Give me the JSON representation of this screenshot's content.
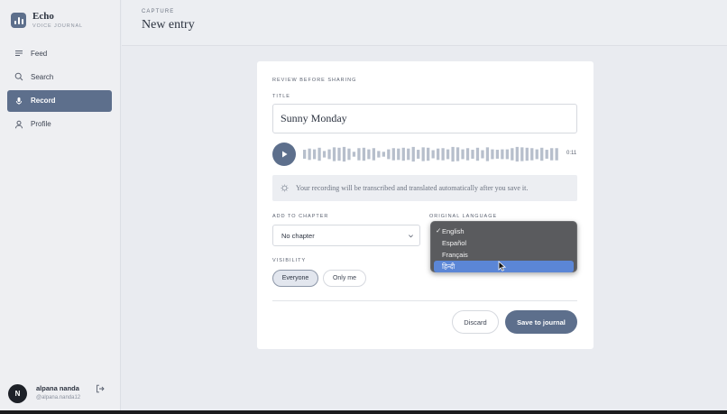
{
  "brand": {
    "name": "Echo",
    "subtitle": "VOICE JOURNAL"
  },
  "sidebar": {
    "items": [
      {
        "label": "Feed",
        "icon": "list-icon",
        "active": false
      },
      {
        "label": "Search",
        "icon": "search-icon",
        "active": false
      },
      {
        "label": "Record",
        "icon": "mic-icon",
        "active": true
      },
      {
        "label": "Profile",
        "icon": "user-icon",
        "active": false
      }
    ]
  },
  "user": {
    "initial": "N",
    "name": "alpana nanda",
    "handle": "@alpana.nanda12"
  },
  "header": {
    "crumb": "CAPTURE",
    "title": "New entry"
  },
  "card": {
    "heading": "REVIEW BEFORE SHARING",
    "title_label": "TITLE",
    "title_value": "Sunny Monday",
    "duration": "0:11",
    "notice": "Your recording will be transcribed and translated automatically after you save it.",
    "chapter_label": "ADD TO CHAPTER",
    "chapter_value": "No chapter",
    "language_label": "ORIGINAL LANGUAGE",
    "visibility_label": "VISIBILITY",
    "visibility_options": [
      "Everyone",
      "Only me"
    ],
    "visibility_selected": "Everyone",
    "discard_label": "Discard",
    "save_label": "Save to journal"
  },
  "language_dropdown": {
    "options": [
      "English",
      "Español",
      "Français",
      "हिन्दी"
    ],
    "checked": "English",
    "hovered": "हिन्दी",
    "check_mark": "✓"
  },
  "waveform_levels": [
    0.55,
    0.7,
    0.6,
    0.8,
    0.4,
    0.6,
    0.85,
    0.8,
    0.9,
    0.7,
    0.3,
    0.75,
    0.8,
    0.6,
    0.75,
    0.4,
    0.3,
    0.6,
    0.75,
    0.7,
    0.8,
    0.7,
    0.9,
    0.55,
    0.85,
    0.8,
    0.5,
    0.7,
    0.75,
    0.6,
    0.9,
    0.85,
    0.6,
    0.75,
    0.55,
    0.8,
    0.5,
    0.85,
    0.6,
    0.55,
    0.6,
    0.6,
    0.75,
    0.9,
    0.85,
    0.8,
    0.75,
    0.6,
    0.8,
    0.55,
    0.75,
    0.75
  ],
  "colors": {
    "accent": "#5d6f8c",
    "dropdown_bg": "#5a5b5e",
    "highlight": "#5b86d6",
    "wave": "#b7bfcc"
  }
}
